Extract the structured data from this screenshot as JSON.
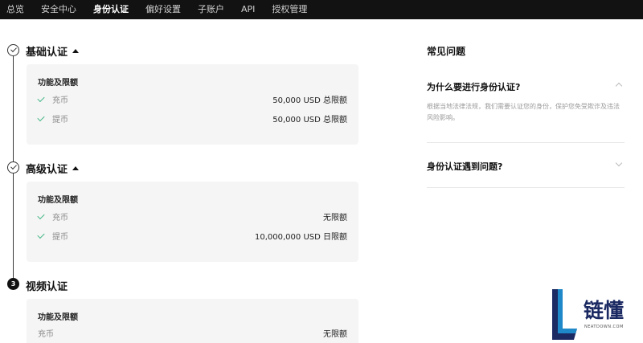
{
  "nav": {
    "items": [
      "总览",
      "安全中心",
      "身份认证",
      "偏好设置",
      "子账户",
      "API",
      "授权管理"
    ],
    "active_index": 2
  },
  "steps": [
    {
      "icon": "check-icon",
      "title": "基础认证",
      "card_title": "功能及限额",
      "rows": [
        {
          "label": "充币",
          "value": "50,000 USD 总限额"
        },
        {
          "label": "提币",
          "value": "50,000 USD 总限额"
        }
      ]
    },
    {
      "icon": "check-icon",
      "title": "高级认证",
      "card_title": "功能及限额",
      "rows": [
        {
          "label": "充币",
          "value": "无限额"
        },
        {
          "label": "提币",
          "value": "10,000,000 USD 日限额"
        }
      ]
    },
    {
      "number": "3",
      "title": "视频认证",
      "card_title": "功能及限额",
      "rows": [
        {
          "label": "充币",
          "value": "无限额"
        }
      ]
    }
  ],
  "faq": {
    "title": "常见问题",
    "items": [
      {
        "question": "为什么要进行身份认证?",
        "answer": "根据当地法律法规，我们需要认证您的身份，保护您免受欺诈及违法风险影响。",
        "expanded": true
      },
      {
        "question": "身份认证遇到问题?",
        "expanded": false
      }
    ]
  },
  "watermark": {
    "brand": "链懂",
    "sub": "NEATDOWN.COM"
  },
  "colors": {
    "nav_bg": "#121212",
    "check": "#48b888",
    "card_bg": "#f5f5f5",
    "brand": "#1c2a63",
    "brand_accent": "#1e88c8"
  }
}
